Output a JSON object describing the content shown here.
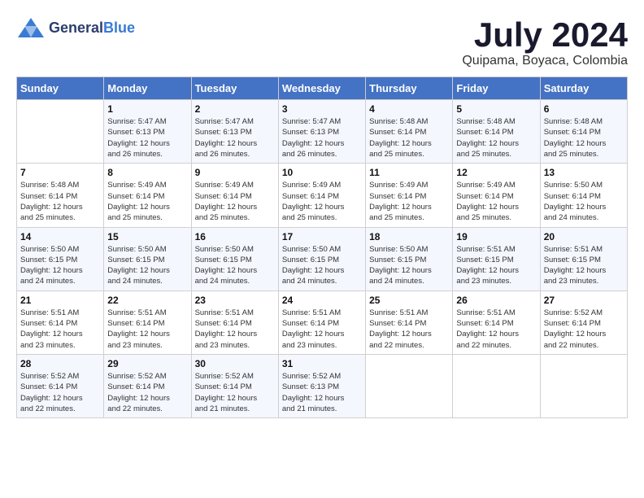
{
  "header": {
    "logo_general": "General",
    "logo_blue": "Blue",
    "month_year": "July 2024",
    "location": "Quipama, Boyaca, Colombia"
  },
  "days_of_week": [
    "Sunday",
    "Monday",
    "Tuesday",
    "Wednesday",
    "Thursday",
    "Friday",
    "Saturday"
  ],
  "weeks": [
    [
      {
        "day": "",
        "info": ""
      },
      {
        "day": "1",
        "info": "Sunrise: 5:47 AM\nSunset: 6:13 PM\nDaylight: 12 hours\nand 26 minutes."
      },
      {
        "day": "2",
        "info": "Sunrise: 5:47 AM\nSunset: 6:13 PM\nDaylight: 12 hours\nand 26 minutes."
      },
      {
        "day": "3",
        "info": "Sunrise: 5:47 AM\nSunset: 6:13 PM\nDaylight: 12 hours\nand 26 minutes."
      },
      {
        "day": "4",
        "info": "Sunrise: 5:48 AM\nSunset: 6:14 PM\nDaylight: 12 hours\nand 25 minutes."
      },
      {
        "day": "5",
        "info": "Sunrise: 5:48 AM\nSunset: 6:14 PM\nDaylight: 12 hours\nand 25 minutes."
      },
      {
        "day": "6",
        "info": "Sunrise: 5:48 AM\nSunset: 6:14 PM\nDaylight: 12 hours\nand 25 minutes."
      }
    ],
    [
      {
        "day": "7",
        "info": "Sunrise: 5:48 AM\nSunset: 6:14 PM\nDaylight: 12 hours\nand 25 minutes."
      },
      {
        "day": "8",
        "info": "Sunrise: 5:49 AM\nSunset: 6:14 PM\nDaylight: 12 hours\nand 25 minutes."
      },
      {
        "day": "9",
        "info": "Sunrise: 5:49 AM\nSunset: 6:14 PM\nDaylight: 12 hours\nand 25 minutes."
      },
      {
        "day": "10",
        "info": "Sunrise: 5:49 AM\nSunset: 6:14 PM\nDaylight: 12 hours\nand 25 minutes."
      },
      {
        "day": "11",
        "info": "Sunrise: 5:49 AM\nSunset: 6:14 PM\nDaylight: 12 hours\nand 25 minutes."
      },
      {
        "day": "12",
        "info": "Sunrise: 5:49 AM\nSunset: 6:14 PM\nDaylight: 12 hours\nand 25 minutes."
      },
      {
        "day": "13",
        "info": "Sunrise: 5:50 AM\nSunset: 6:14 PM\nDaylight: 12 hours\nand 24 minutes."
      }
    ],
    [
      {
        "day": "14",
        "info": "Sunrise: 5:50 AM\nSunset: 6:15 PM\nDaylight: 12 hours\nand 24 minutes."
      },
      {
        "day": "15",
        "info": "Sunrise: 5:50 AM\nSunset: 6:15 PM\nDaylight: 12 hours\nand 24 minutes."
      },
      {
        "day": "16",
        "info": "Sunrise: 5:50 AM\nSunset: 6:15 PM\nDaylight: 12 hours\nand 24 minutes."
      },
      {
        "day": "17",
        "info": "Sunrise: 5:50 AM\nSunset: 6:15 PM\nDaylight: 12 hours\nand 24 minutes."
      },
      {
        "day": "18",
        "info": "Sunrise: 5:50 AM\nSunset: 6:15 PM\nDaylight: 12 hours\nand 24 minutes."
      },
      {
        "day": "19",
        "info": "Sunrise: 5:51 AM\nSunset: 6:15 PM\nDaylight: 12 hours\nand 23 minutes."
      },
      {
        "day": "20",
        "info": "Sunrise: 5:51 AM\nSunset: 6:15 PM\nDaylight: 12 hours\nand 23 minutes."
      }
    ],
    [
      {
        "day": "21",
        "info": "Sunrise: 5:51 AM\nSunset: 6:14 PM\nDaylight: 12 hours\nand 23 minutes."
      },
      {
        "day": "22",
        "info": "Sunrise: 5:51 AM\nSunset: 6:14 PM\nDaylight: 12 hours\nand 23 minutes."
      },
      {
        "day": "23",
        "info": "Sunrise: 5:51 AM\nSunset: 6:14 PM\nDaylight: 12 hours\nand 23 minutes."
      },
      {
        "day": "24",
        "info": "Sunrise: 5:51 AM\nSunset: 6:14 PM\nDaylight: 12 hours\nand 23 minutes."
      },
      {
        "day": "25",
        "info": "Sunrise: 5:51 AM\nSunset: 6:14 PM\nDaylight: 12 hours\nand 22 minutes."
      },
      {
        "day": "26",
        "info": "Sunrise: 5:51 AM\nSunset: 6:14 PM\nDaylight: 12 hours\nand 22 minutes."
      },
      {
        "day": "27",
        "info": "Sunrise: 5:52 AM\nSunset: 6:14 PM\nDaylight: 12 hours\nand 22 minutes."
      }
    ],
    [
      {
        "day": "28",
        "info": "Sunrise: 5:52 AM\nSunset: 6:14 PM\nDaylight: 12 hours\nand 22 minutes."
      },
      {
        "day": "29",
        "info": "Sunrise: 5:52 AM\nSunset: 6:14 PM\nDaylight: 12 hours\nand 22 minutes."
      },
      {
        "day": "30",
        "info": "Sunrise: 5:52 AM\nSunset: 6:14 PM\nDaylight: 12 hours\nand 21 minutes."
      },
      {
        "day": "31",
        "info": "Sunrise: 5:52 AM\nSunset: 6:13 PM\nDaylight: 12 hours\nand 21 minutes."
      },
      {
        "day": "",
        "info": ""
      },
      {
        "day": "",
        "info": ""
      },
      {
        "day": "",
        "info": ""
      }
    ]
  ]
}
